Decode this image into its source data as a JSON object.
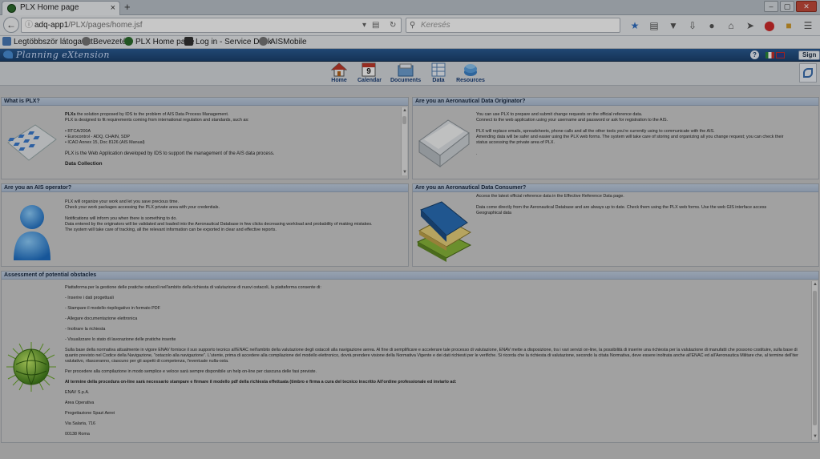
{
  "browser": {
    "tab_title": "PLX Home page",
    "tab_close": "×",
    "new_tab": "+",
    "url_host": "adq-app1",
    "url_path": "/PLX/pages/home.jsf",
    "search_placeholder": "Keresés",
    "window_buttons": [
      "‒",
      "▢",
      "✕"
    ],
    "bookmarks": [
      {
        "label": "Legtöbbször látogatott"
      },
      {
        "label": "Bevezetés"
      },
      {
        "label": "PLX Home page"
      },
      {
        "label": "Log in - Service Desk"
      },
      {
        "label": "AISMobile"
      }
    ]
  },
  "app": {
    "logo_text": "Planning eXtension",
    "help_label": "?",
    "sign_in_label": "Sign in",
    "calendar_day": "9",
    "menu": [
      {
        "label": "Home",
        "icon": "home-icon"
      },
      {
        "label": "Calendar",
        "icon": "calendar-icon"
      },
      {
        "label": "Documents",
        "icon": "documents-icon"
      },
      {
        "label": "Data",
        "icon": "data-icon"
      },
      {
        "label": "Resources",
        "icon": "resources-icon"
      }
    ]
  },
  "panels": {
    "what_is_plx": {
      "title": "What is PLX?",
      "intro_bold": "PLXs",
      "intro_rest": " the solution proposed by IDS to the problem of AIS Data Process Management.",
      "line2": "PLX is designed to fit requirements coming from international regulation and standards, such as:",
      "list": [
        "RTCA/200A",
        "Eurocontrol - ADQ, CHAIN, SDP",
        "ICAO Annex 15, Doc 8126 (AIS Manual)"
      ],
      "line3": "PLX is the Web Application developed by IDS to support the management of the AIS data process.",
      "subheading": "Data Collection"
    },
    "originator": {
      "title": "Are you an Aeronautical Data Originator?",
      "lines": [
        "You can use PLX to prepare and submit change requests on the official reference data.",
        "Connect to the web application using your username and password or ask for registration to the AIS.",
        "",
        "PLX will replace emails, spreadsheets, phone calls and all the other tools you're currently using to communicate with the AIS.",
        "Amending data will be safer and easier using the PLX web forms. The system will take care of storing and organizing all you change request; you can check their",
        "status accessing the private area of PLX.",
        "",
        "."
      ]
    },
    "operator": {
      "title": "Are you an AIS operator?",
      "lines": [
        "PLX will organize your work and let you save precious time.",
        "Check your work packages accessing the PLX private area with your credentials.",
        "",
        "Notifications will inform you when there is something to do.",
        "Data entered by the originators will be validated and loaded into the Aeronautical Database in few clicks decreasing workload and probability of making mistakes.",
        "The system will take care of tracking, all the relevant information can be exported in clear and effective reports."
      ]
    },
    "consumer": {
      "title": "Are you an Aeronautical Data Consumer?",
      "lines": [
        "Access the latest official reference data in the Effective Reference Data page.",
        "",
        "Data come directly from the Aeronautical Database and are always up to date. Check them using the PLX web forms. Use the web GIS interface access",
        "Geographical data"
      ]
    },
    "obstacles": {
      "title": "Assessment of potential obstacles",
      "intro": "Piattaforma per la gestione delle pratiche ostacoli nell'ambito della richiesta di valutazione di nuovi ostacoli, la piattaforma consente di:",
      "items": [
        "- Inserire i dati progettuali",
        "- Stampare il modello riepilogativo in formato PDF",
        "- Allegare documentazione elettronica",
        "- Inoltrare la richiesta",
        "- Visualizzare lo stato di lavorazione delle pratiche inserite"
      ],
      "paragraph": "Sulla base della normativa attualmente in vigore ENAV fornisce il suo supporto tecnico all'ENAC nell'ambito della valutazione degli ostacoli alla navigazione aerea. Al fine di semplificare e accelerare tale processo di valutazione, ENAV mette a disposizione, tra i vari servizi on-line, la possibilità di inserire una richiesta per la valutazione di manufatti che possono costituire, sulla base di quanto previsto nel Codice della Navigazione, \"ostacolo alla navigazione\". L'utente, prima di accedere alla compilazione del modello elettronico, dovrà prendere visione della Normativa Vigente e dei dati richiesti per le verifiche. Si ricorda che la richiesta di valutazione, secondo la citata Normativa, deve essere inoltrata anche all'ENAC ed all'Aeronautica Militare che, al termine dell'iter valutativo, rilasceranno, ciascuno per gli aspetti di competenza, l'eventuale nulla-osta.",
      "help_line": "Per procedere alla compilazione in modo semplice e veloce sarà sempre disponibile un help on-line per ciascuna delle fasi previste.",
      "bold_line": "Al termine della procedura on-line sarà necessario stampare e firmare il modello pdf della richiesta effettuata (timbro e firma a cura del tecnico inscritto All'ordine professionale ed inviarlo ad:",
      "address": [
        "ENAV S.p.A.",
        "Area Operativa",
        "Progettazione Spazi Aerei",
        "Via Salaria, 716",
        "00138 Roma"
      ]
    }
  },
  "colors": {
    "app_header": "#1c426f",
    "panel_title": "#b4c3d8",
    "menu_text": "#1a3f78"
  }
}
